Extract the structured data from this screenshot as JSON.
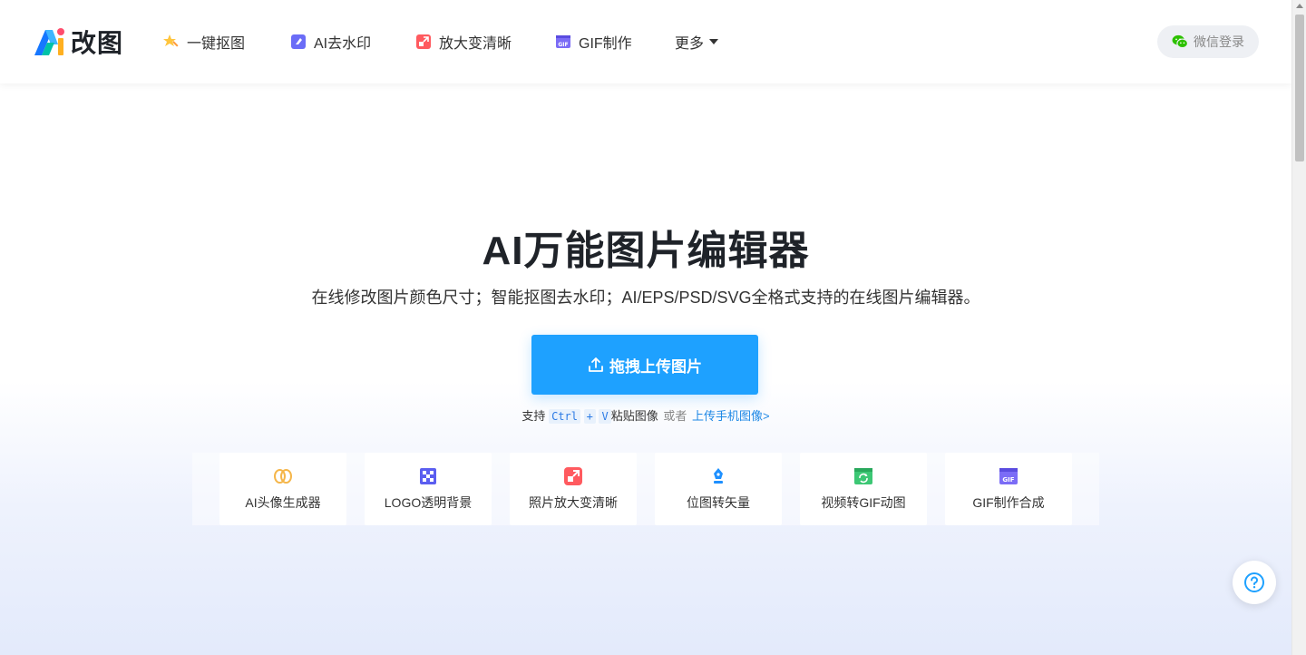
{
  "brand": {
    "logo_text": "改图",
    "accent": "#1ea1ff"
  },
  "nav": {
    "items": [
      {
        "label": "一键抠图",
        "icon": "star-magic-icon"
      },
      {
        "label": "AI去水印",
        "icon": "eraser-icon"
      },
      {
        "label": "放大变清晰",
        "icon": "enlarge-icon"
      },
      {
        "label": "GIF制作",
        "icon": "gif-icon"
      }
    ],
    "more_label": "更多"
  },
  "login": {
    "label": "微信登录",
    "icon": "wechat-icon"
  },
  "hero": {
    "title": "AI万能图片编辑器",
    "subtitle": "在线修改图片颜色尺寸；智能抠图去水印；AI/EPS/PSD/SVG全格式支持的在线图片编辑器。",
    "upload_label": "拖拽上传图片"
  },
  "hint": {
    "prefix": "支持",
    "key1": "Ctrl",
    "plus": "+",
    "key2": "V",
    "suffix": "粘贴图像",
    "or": "或者",
    "mobile_link": "上传手机图像>"
  },
  "tools": [
    {
      "label": "AI头像生成器",
      "icon": "avatar-ai-icon"
    },
    {
      "label": "LOGO透明背景",
      "icon": "transparent-grid-icon"
    },
    {
      "label": "照片放大变清晰",
      "icon": "enlarge-icon"
    },
    {
      "label": "位图转矢量",
      "icon": "pen-vector-icon"
    },
    {
      "label": "视频转GIF动图",
      "icon": "video-convert-icon"
    },
    {
      "label": "GIF制作合成",
      "icon": "gif-icon"
    }
  ]
}
